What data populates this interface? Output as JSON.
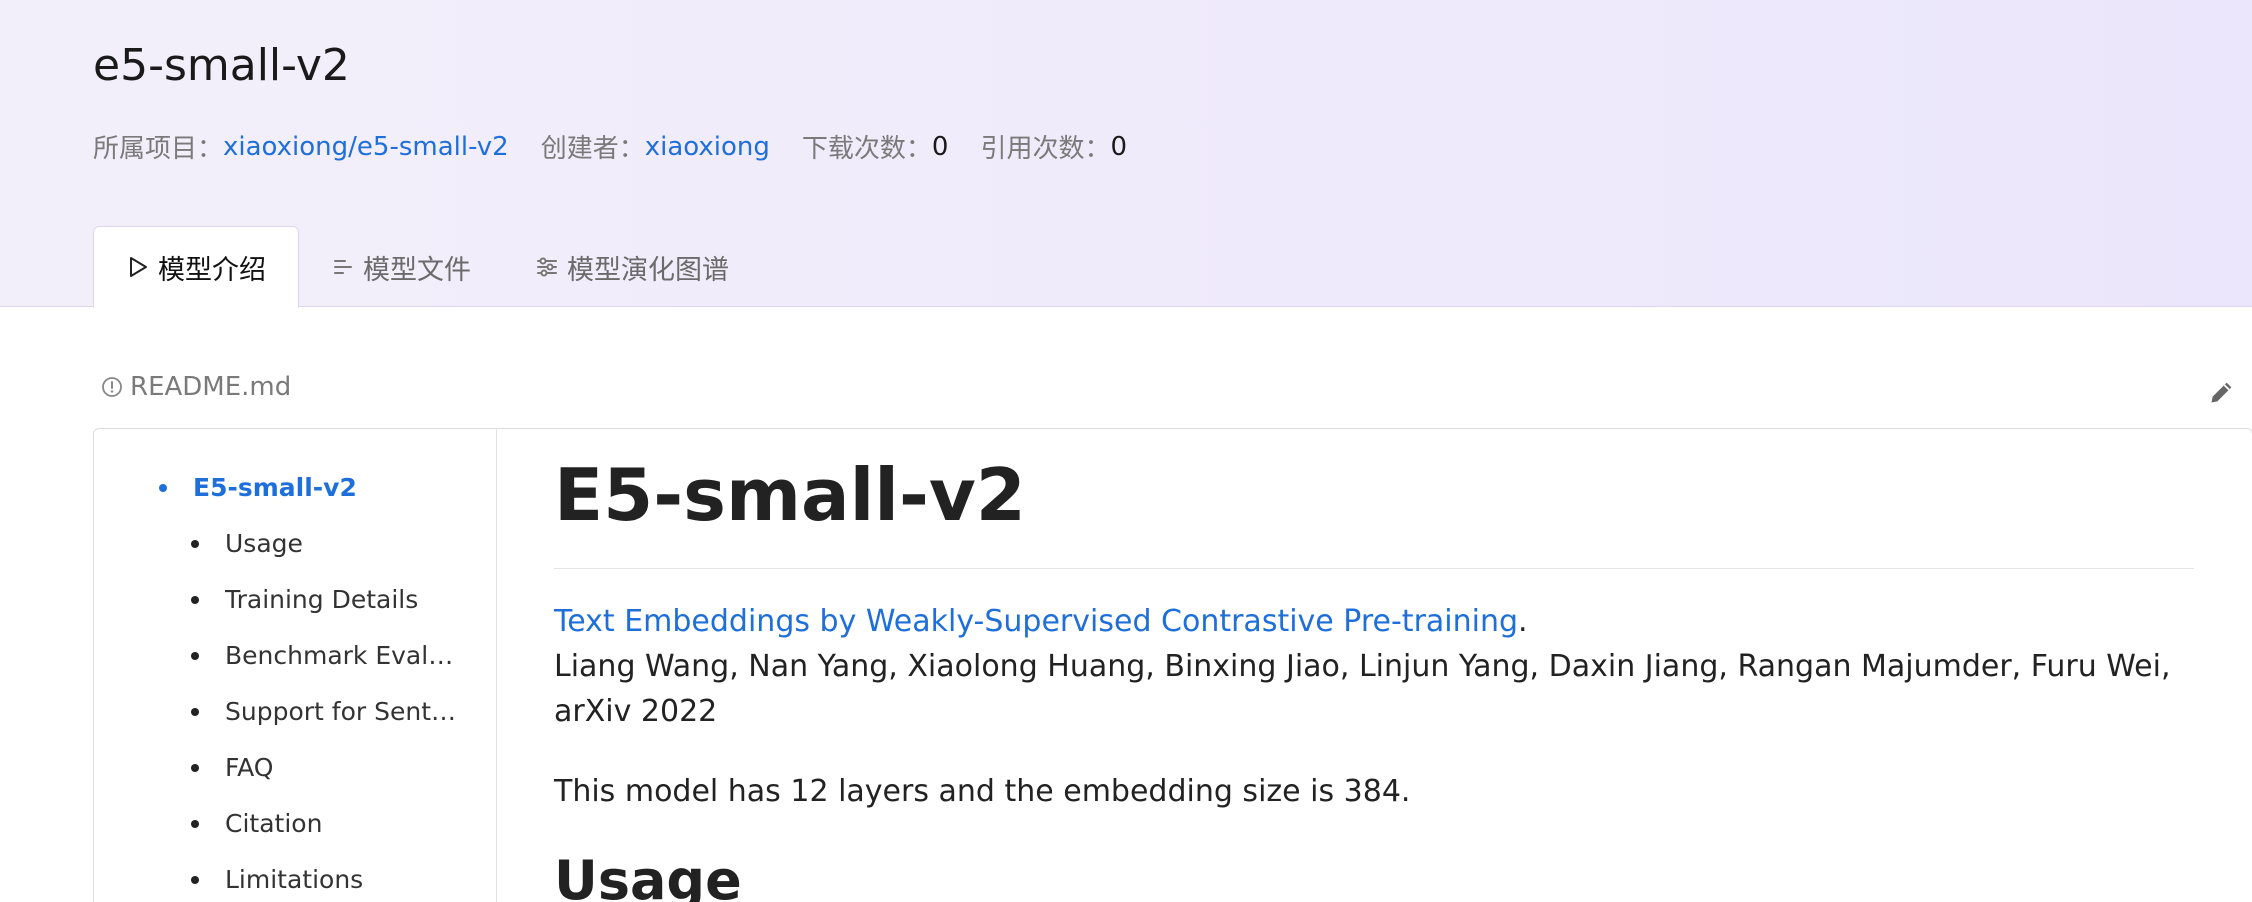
{
  "header": {
    "title": "e5-small-v2",
    "project_label": "所属项目：",
    "project_link": "xiaoxiong/e5-small-v2",
    "creator_label": "创建者：",
    "creator_link": "xiaoxiong",
    "downloads_label": "下载次数：",
    "downloads_value": "0",
    "citations_label": "引用次数：",
    "citations_value": "0"
  },
  "tabs": [
    {
      "label": "模型介绍",
      "icon": "play-outline-icon",
      "active": true
    },
    {
      "label": "模型文件",
      "icon": "file-lines-icon",
      "active": false
    },
    {
      "label": "模型演化图谱",
      "icon": "sliders-icon",
      "active": false
    }
  ],
  "readme": {
    "filename": "README.md",
    "info_icon": "info-circle-icon",
    "edit_icon": "pencil-icon"
  },
  "toc": {
    "main": "E5-small-v2",
    "items": [
      "Usage",
      "Training Details",
      "Benchmark Evaluation",
      "Support for Sentence Transformers",
      "FAQ",
      "Citation",
      "Limitations"
    ]
  },
  "content": {
    "h1": "E5-small-v2",
    "paper_link": "Text Embeddings by Weakly-Supervised Contrastive Pre-training",
    "paper_suffix": ".",
    "authors": "Liang Wang, Nan Yang, Xiaolong Huang, Binxing Jiao, Linjun Yang, Daxin Jiang, Rangan Majumder, Furu Wei, arXiv 2022",
    "model_info": "This model has 12 layers and the embedding size is 384.",
    "h2": "Usage"
  },
  "colors": {
    "accent": "#1e6fd9",
    "header_bg": "#f1edfa"
  }
}
